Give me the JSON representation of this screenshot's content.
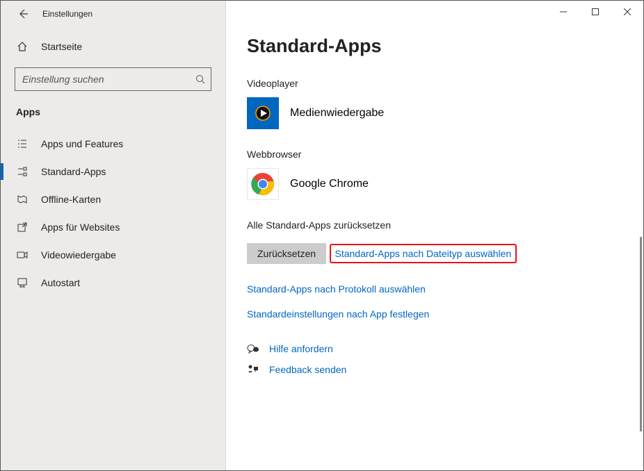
{
  "window": {
    "title": "Einstellungen"
  },
  "sidebar": {
    "home_label": "Startseite",
    "search_placeholder": "Einstellung suchen",
    "section_title": "Apps",
    "items": [
      {
        "label": "Apps und Features"
      },
      {
        "label": "Standard-Apps"
      },
      {
        "label": "Offline-Karten"
      },
      {
        "label": "Apps für Websites"
      },
      {
        "label": "Videowiedergabe"
      },
      {
        "label": "Autostart"
      }
    ]
  },
  "main": {
    "title": "Standard-Apps",
    "videoplayer_heading": "Videoplayer",
    "videoplayer_app": "Medienwiedergabe",
    "webbrowser_heading": "Webbrowser",
    "webbrowser_app": "Google Chrome",
    "reset_heading": "Alle Standard-Apps zurücksetzen",
    "reset_button": "Zurücksetzen",
    "link_filetype": "Standard-Apps nach Dateityp auswählen",
    "link_protocol": "Standard-Apps nach Protokoll auswählen",
    "link_byapp": "Standardeinstellungen nach App festlegen",
    "help_label": "Hilfe anfordern",
    "feedback_label": "Feedback senden"
  }
}
